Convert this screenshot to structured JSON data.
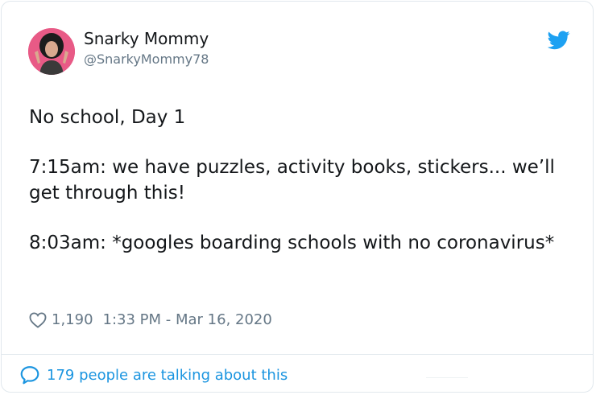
{
  "tweet": {
    "author_name": "Snarky Mommy",
    "author_handle": "@SnarkyMommy78",
    "paragraphs": [
      "No school, Day 1",
      "7:15am: we have puzzles, activity books, stickers... we’ll get through this!",
      "8:03am: *googles boarding schools with no coronavirus*"
    ],
    "likes": "1,190",
    "timestamp": "1:33 PM - Mar 16, 2020",
    "talking": "179 people are talking about this"
  },
  "icons": {
    "brand": "twitter-bird-icon",
    "like": "heart-outline-icon",
    "reply": "speech-bubble-icon"
  },
  "colors": {
    "brand": "#1da1f2",
    "link": "#1b95e0",
    "text": "#14171a",
    "muted": "#657786",
    "border": "#e1e8ed"
  }
}
